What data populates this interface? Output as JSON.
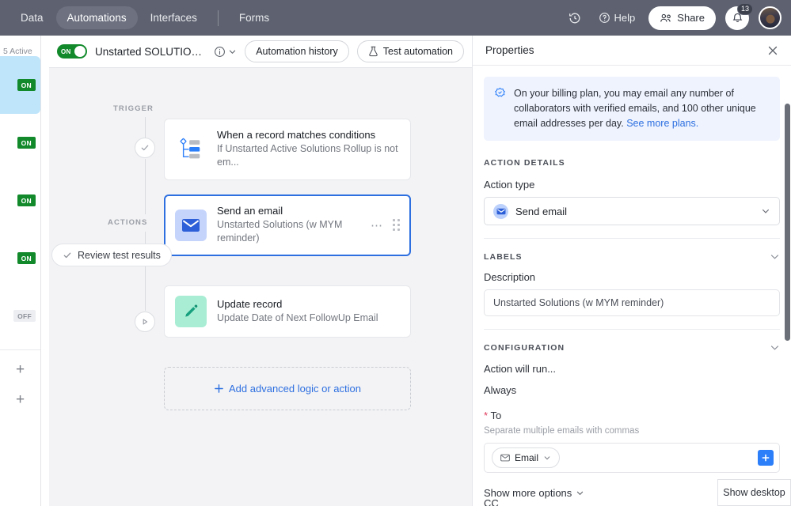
{
  "topbar": {
    "tabs": [
      {
        "label": "Data",
        "active": false
      },
      {
        "label": "Automations",
        "active": true
      },
      {
        "label": "Interfaces",
        "active": false
      },
      {
        "label": "Forms",
        "active": false
      }
    ],
    "history_icon": "history-icon",
    "help_label": "Help",
    "help_icon": "question-circle-icon",
    "share_label": "Share",
    "share_icon": "people-icon",
    "bell_icon": "bell-icon",
    "notification_count": "13",
    "avatar": "user-avatar"
  },
  "sidebar": {
    "active_count_label": "5 Active",
    "items": [
      {
        "status": "ON",
        "selected": true
      },
      {
        "status": "ON",
        "selected": false
      },
      {
        "status": "ON",
        "selected": false
      },
      {
        "status": "ON",
        "selected": false
      },
      {
        "status": "OFF",
        "selected": false
      }
    ],
    "add_label": "+",
    "add_label_2": "+"
  },
  "automation_header": {
    "toggle_state": "ON",
    "title": "Unstarted SOLUTIONS Email to ...",
    "info_icon": "info-circle-icon",
    "chevron_icon": "chevron-down-icon",
    "history_button": "Automation history",
    "test_button": "Test automation",
    "test_icon": "flask-icon"
  },
  "canvas": {
    "trigger_label": "TRIGGER",
    "actions_label": "ACTIONS",
    "review_pill": "Review test results",
    "review_icon": "check-icon",
    "trigger_node_icon": "check-circle-icon",
    "run_node_icon": "play-icon",
    "nodes": [
      {
        "icon": "record-conditions-icon",
        "title": "When a record matches conditions",
        "subtitle": "If Unstarted Active Solutions Rollup is not em...",
        "selected": false,
        "kind": "trigger"
      },
      {
        "icon": "envelope-icon",
        "title": "Send an email",
        "subtitle": "Unstarted Solutions (w MYM reminder)",
        "selected": true,
        "kind": "action",
        "more_icon": "ellipsis-icon",
        "drag_icon": "drag-handle-icon"
      },
      {
        "icon": "pencil-icon",
        "title": "Update record",
        "subtitle": "Update Date of Next FollowUp Email",
        "selected": false,
        "kind": "action"
      }
    ],
    "add_action_label": "Add advanced logic or action",
    "add_action_icon": "plus-icon"
  },
  "properties": {
    "title": "Properties",
    "close_icon": "close-icon",
    "banner": {
      "icon": "badge-star-icon",
      "text": "On your billing plan, you may email any number of collaborators with verified emails, and 100 other unique email addresses per day.",
      "link": "See more plans."
    },
    "action_details": {
      "section_title": "ACTION DETAILS",
      "action_type_label": "Action type",
      "action_type_value": "Send email",
      "action_type_icon": "envelope-icon",
      "chevron_icon": "chevron-down-icon"
    },
    "labels": {
      "section_title": "LABELS",
      "collapse_icon": "chevron-down-icon",
      "description_label": "Description",
      "description_value": "Unstarted Solutions (w MYM reminder)"
    },
    "configuration": {
      "section_title": "CONFIGURATION",
      "collapse_icon": "chevron-down-icon",
      "run_when_label": "Action will run...",
      "run_when_value": "Always",
      "to_label": "To",
      "to_required": "*",
      "to_hint": "Separate multiple emails with commas",
      "to_chip_label": "Email",
      "to_chip_icon": "envelope-outline-icon",
      "to_chip_chevron": "chevron-down-icon",
      "add_icon": "plus-square-icon",
      "show_more_label": "Show more options",
      "show_more_icon": "chevron-down-icon",
      "cc_label": "CC"
    }
  },
  "taskbar": {
    "show_desktop_label": "Show desktop"
  },
  "colors": {
    "topbar_bg": "#5e6270",
    "accent_blue": "#2d7ff9",
    "link_blue": "#2d6fe0",
    "toggle_green": "#128a2b",
    "selected_row": "#bfe5fb",
    "canvas_bg": "#f3f3f5",
    "required_red": "#e0385a"
  }
}
